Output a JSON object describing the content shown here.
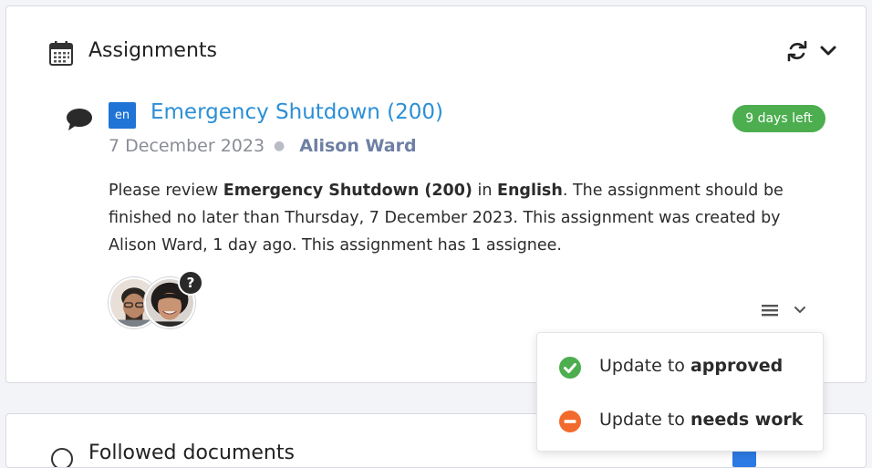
{
  "header": {
    "title": "Assignments",
    "calendar_icon": "calendar-icon",
    "refresh_icon": "refresh-icon",
    "collapse_icon": "chevron-down-icon"
  },
  "assignment": {
    "language_code": "en",
    "document_title": "Emergency Shutdown (200)",
    "days_left": "9 days left",
    "date": "7 December 2023",
    "author": "Alison Ward",
    "description": {
      "p1": "Please review ",
      "doc": "Emergency Shutdown (200)",
      "p2": " in ",
      "lang": "English",
      "p3": ". The assignment should be finished no later than Thursday, 7 December 2023. This assignment was created by Alison Ward, 1 day ago. This assignment has 1 assignee."
    },
    "assignee_status_badge": "?"
  },
  "dropdown": {
    "approve_prefix": "Update to ",
    "approve_strong": "approved",
    "needs_work_prefix": "Update to ",
    "needs_work_strong": "needs work"
  },
  "next_card": {
    "title": "Followed documents"
  },
  "colors": {
    "link": "#2b8fd6",
    "lang_badge": "#1f74d6",
    "days_badge": "#4cae4f",
    "approve": "#4cae4f",
    "needs_work": "#f26a2c"
  }
}
